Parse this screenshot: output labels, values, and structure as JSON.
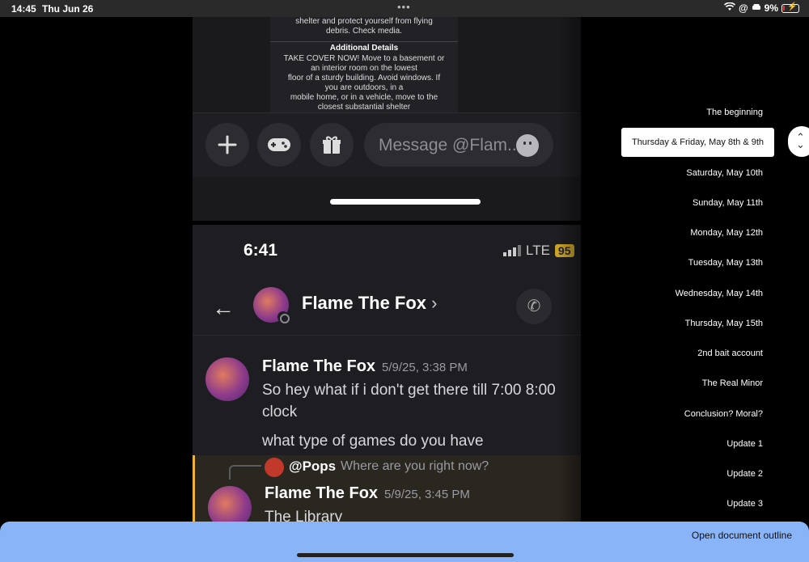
{
  "status_bar": {
    "time": "14:45",
    "date": "Thu Jun 26",
    "battery": "9%"
  },
  "screenshot": {
    "alert": {
      "line1": "shelter and protect yourself from flying",
      "line2": "debris. Check media.",
      "heading": "Additional Details",
      "body": [
        "TAKE COVER NOW! Move to a basement or",
        "an interior room on the lowest",
        "floor of a sturdy building. Avoid windows. If",
        "you are outdoors, in a",
        "mobile home, or in a vehicle, move to the",
        "closest substantial shelter"
      ]
    },
    "composer": {
      "placeholder": "Message @Flam..."
    },
    "phone_status": {
      "time": "6:41",
      "network": "LTE",
      "battery": "95"
    },
    "dm_header": {
      "name": "Flame The Fox"
    },
    "messages": [
      {
        "author": "Flame The Fox",
        "timestamp": "5/9/25, 3:38 PM",
        "line1": "So hey what if i don't get there till 7:00 8:00",
        "line2": "clock",
        "line3": "what type of games do you have"
      },
      {
        "reply_to": "@Pops",
        "reply_text": "Where are you right now?",
        "author": "Flame The Fox",
        "timestamp": "5/9/25, 3:45 PM",
        "text": "The Library"
      }
    ]
  },
  "outline": {
    "items": [
      "The beginning",
      "Thursday & Friday, May 8th & 9th",
      "Saturday, May 10th",
      "Sunday, May 11th",
      "Monday, May 12th",
      "Tuesday, May 13th",
      "Wednesday, May 14th",
      "Thursday, May 15th",
      "2nd bait account",
      "The Real Minor",
      "Conclusion? Moral?",
      "Update 1",
      "Update 2",
      "Update 3"
    ],
    "active_index": 1
  },
  "bottom_bar": {
    "open_outline_label": "Open document outline"
  }
}
